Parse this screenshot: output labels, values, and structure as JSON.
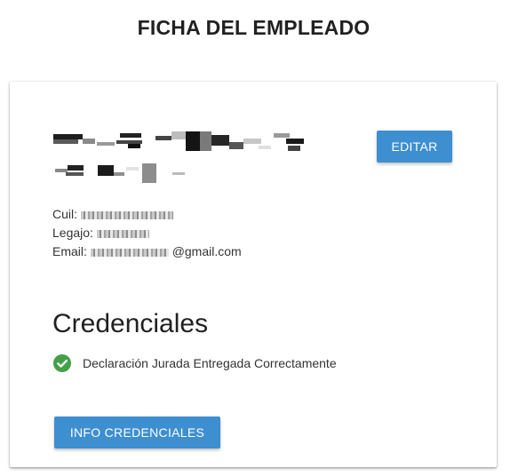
{
  "page": {
    "title": "FICHA DEL EMPLEADO"
  },
  "employee": {
    "edit_label": "EDITAR",
    "cuil_label": "Cuil:",
    "legajo_label": "Legajo:",
    "email_label": "Email:",
    "email_domain": "@gmail.com"
  },
  "credentials": {
    "heading": "Credenciales",
    "status_text": "Declaración Jurada Entregada Correctamente",
    "status_icon": "check-circle-icon",
    "status_color": "#43a047",
    "info_button_label": "INFO CREDENCIALES"
  },
  "theme": {
    "button_color": "#3d8fcf"
  }
}
